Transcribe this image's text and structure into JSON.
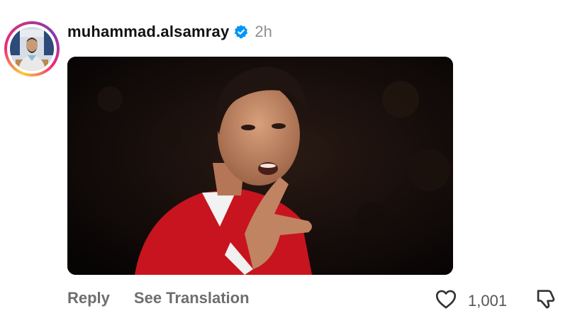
{
  "comment": {
    "username": "muhammad.alsamray",
    "verified": true,
    "time": "2h",
    "like_count": "1,001",
    "actions": {
      "reply": "Reply",
      "see_translation": "See Translation"
    }
  },
  "icons": {
    "verified": "verified-badge-icon",
    "like": "heart-outline-icon",
    "dislike": "thumbs-down-outline-icon"
  },
  "colors": {
    "verified_blue": "#0095f6",
    "muted_text": "#8e8e8e",
    "action_text": "#6e6e6e"
  }
}
